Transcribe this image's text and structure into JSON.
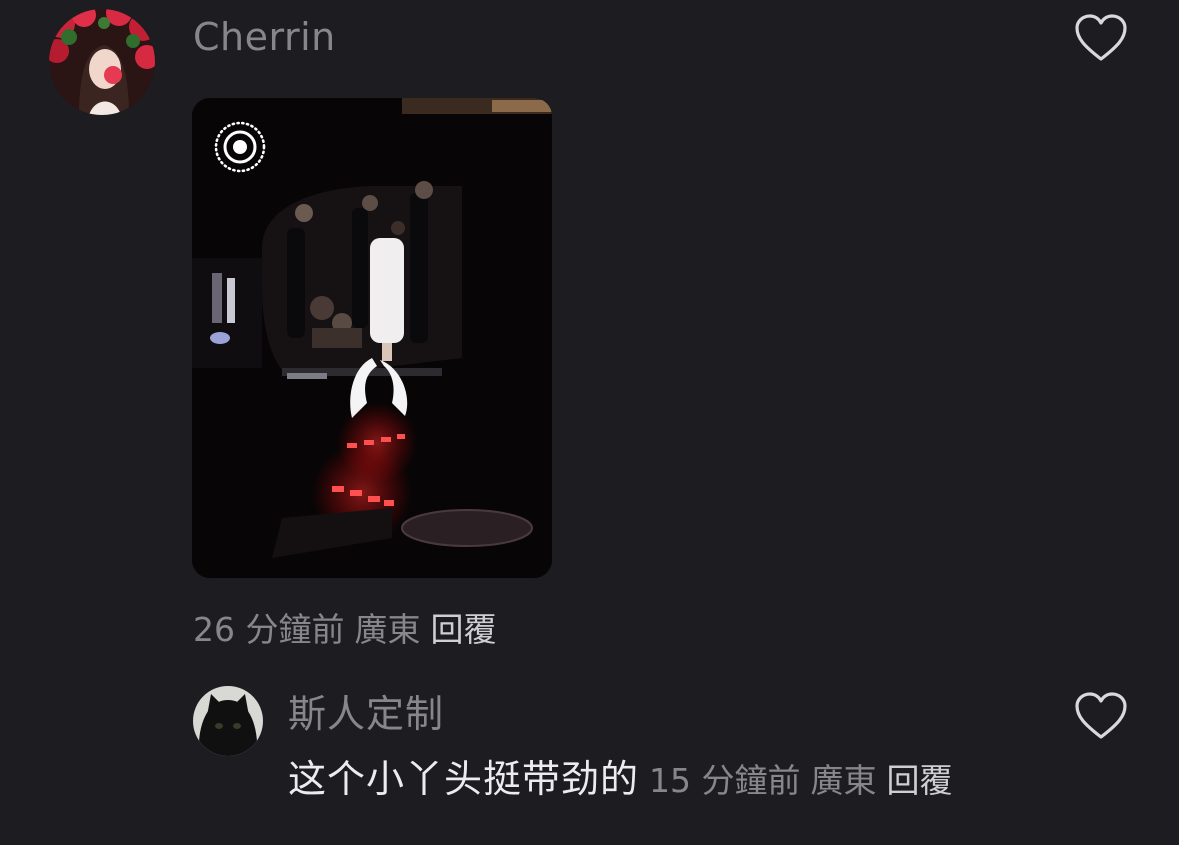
{
  "comments": [
    {
      "username": "Cherrin",
      "avatar": "avatar-red-roses",
      "has_photo": true,
      "photo_icon": "live-photo-icon",
      "time": "26 分鐘前",
      "location": "廣東",
      "reply_label": "回覆",
      "like_icon": "heart-outline-icon"
    },
    {
      "username": "斯人定制",
      "avatar": "avatar-black-cat",
      "text": "这个小丫头挺带劲的",
      "time": "15 分鐘前",
      "location": "廣東",
      "reply_label": "回覆",
      "like_icon": "heart-outline-icon"
    }
  ],
  "colors": {
    "background": "#1c1c21",
    "muted_text": "#86868b",
    "primary_text": "#ececee",
    "reply_text": "#cfcfd3"
  }
}
